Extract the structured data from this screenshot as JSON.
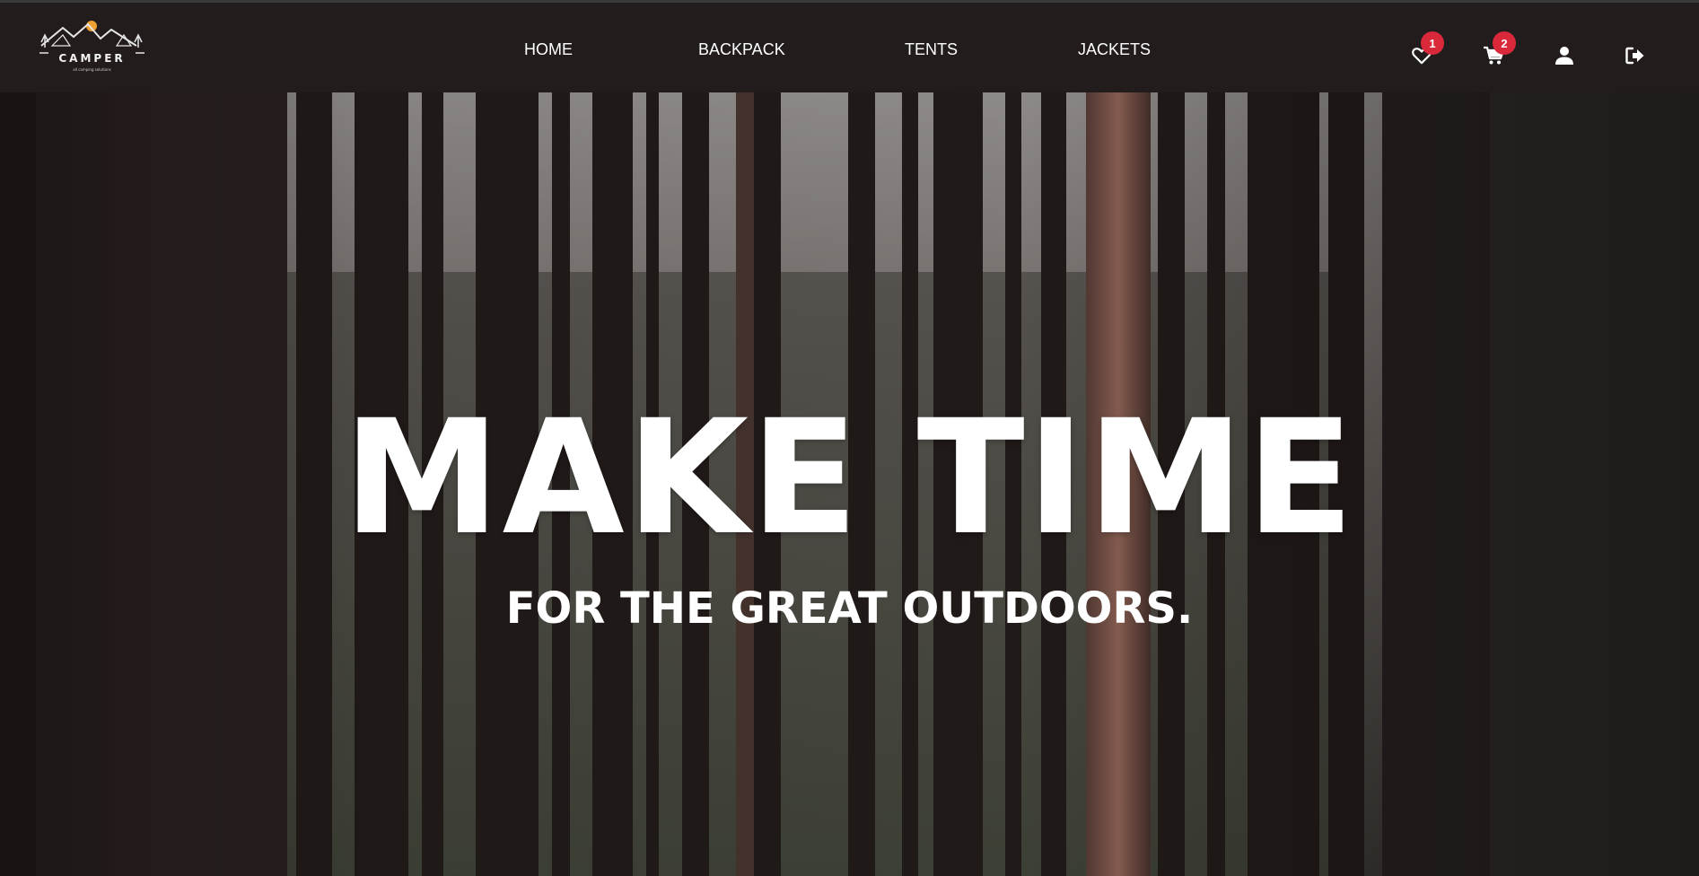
{
  "brand": {
    "name": "CAMPER",
    "tagline": "all camping solutions",
    "accent_color": "#f0a030"
  },
  "nav": {
    "links": [
      {
        "label": "HOME"
      },
      {
        "label": "BACKPACK"
      },
      {
        "label": "TENTS"
      },
      {
        "label": "JACKETS"
      }
    ],
    "icons": [
      {
        "icon": "heart-icon",
        "badge": "1"
      },
      {
        "icon": "cart-icon",
        "badge": "2"
      },
      {
        "icon": "user-icon"
      },
      {
        "icon": "logout-icon"
      }
    ],
    "badge_color": "#d9283a",
    "background": "#221d1c"
  },
  "hero": {
    "title": "MAKE TIME",
    "subtitle": "FOR THE GREAT OUTDOORS.",
    "image": "forest-background"
  }
}
